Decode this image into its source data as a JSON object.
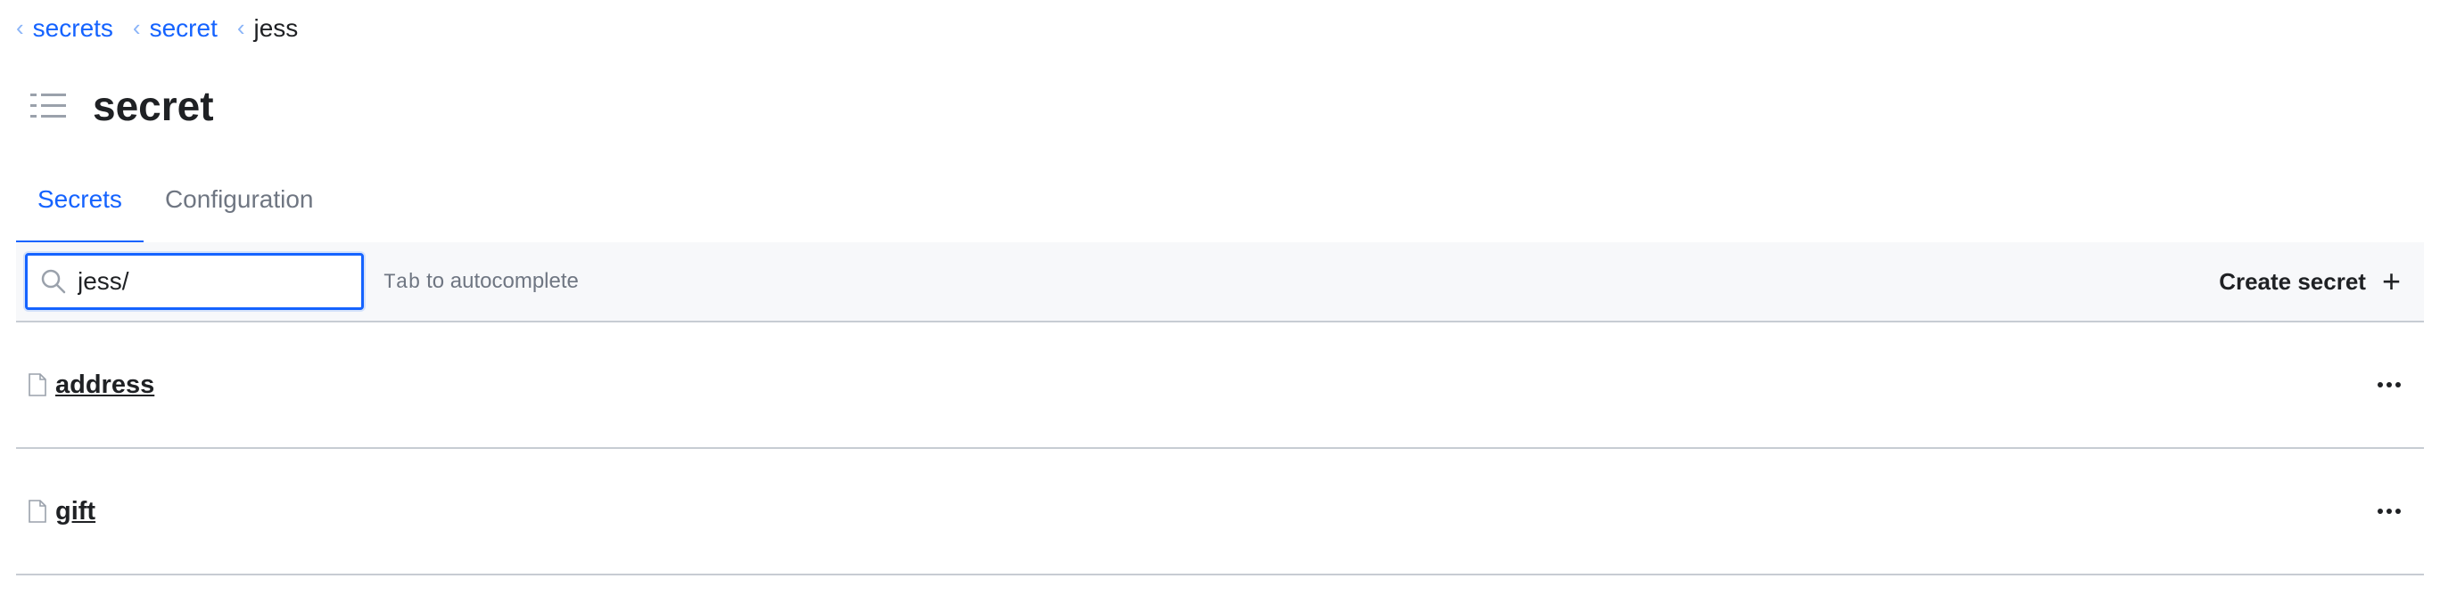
{
  "breadcrumb": {
    "items": [
      {
        "label": "secrets"
      },
      {
        "label": "secret"
      },
      {
        "label": "jess"
      }
    ]
  },
  "page": {
    "title": "secret"
  },
  "tabs": [
    {
      "label": "Secrets",
      "active": true
    },
    {
      "label": "Configuration",
      "active": false
    }
  ],
  "toolbar": {
    "search_value": "jess/",
    "hint_key": "Tab",
    "hint_text": " to autocomplete",
    "create_label": "Create secret",
    "create_icon": "+"
  },
  "secrets": [
    {
      "name": "address",
      "icon": "file-icon"
    },
    {
      "name": "gift",
      "icon": "file-icon"
    }
  ],
  "colors": {
    "accent": "#1563ff",
    "divider": "#c7ccd3"
  }
}
